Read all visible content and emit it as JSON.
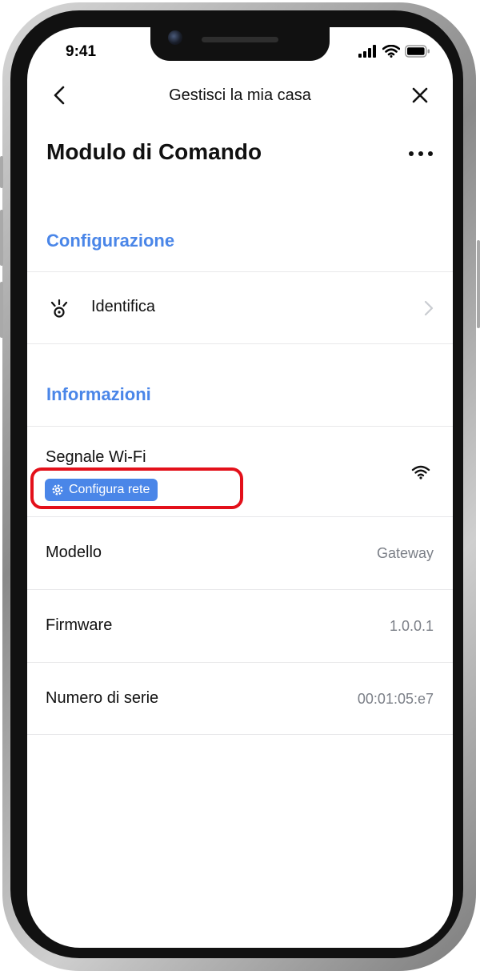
{
  "status_bar": {
    "time": "9:41"
  },
  "nav": {
    "title": "Gestisci la mia casa"
  },
  "page": {
    "title": "Modulo di Comando"
  },
  "sections": {
    "configuration": {
      "header": "Configurazione",
      "identify_label": "Identifica"
    },
    "information": {
      "header": "Informazioni",
      "wifi_label": "Segnale Wi-Fi",
      "configure_network_label": "Configura rete",
      "model_label": "Modello",
      "model_value": "Gateway",
      "firmware_label": "Firmware",
      "firmware_value": "1.0.0.1",
      "serial_label": "Numero di serie",
      "serial_value": "00:01:05:e7"
    }
  },
  "colors": {
    "accent": "#4a86e8",
    "highlight": "#e3101a",
    "secondary_text": "#7b7f87"
  },
  "icons": [
    "back-arrow-icon",
    "close-icon",
    "more-icon",
    "identify-icon",
    "chevron-right-icon",
    "gear-icon",
    "wifi-signal-icon"
  ]
}
